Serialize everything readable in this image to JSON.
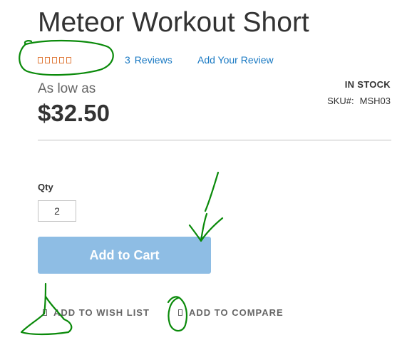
{
  "product": {
    "title": "Meteor Workout Short",
    "rating_stars": 5,
    "reviews_count": "3",
    "reviews_label": "Reviews",
    "add_review_label": "Add Your Review",
    "as_low_as_label": "As low as",
    "price": "$32.50",
    "stock_status": "IN STOCK",
    "sku_label": "SKU#:",
    "sku_value": "MSH03"
  },
  "cart": {
    "qty_label": "Qty",
    "qty_value": "2",
    "add_to_cart_label": "Add to Cart"
  },
  "actions": {
    "wishlist_label": "Add to Wish List",
    "compare_label": "Add to Compare"
  },
  "colors": {
    "link": "#1979c3",
    "button": "#8ebde4",
    "star_outline": "#e07b3c",
    "annotation": "#0a8a0a"
  },
  "icons": {
    "star": "star-outline-icon",
    "wishlist": "heart-icon",
    "compare": "compare-icon"
  }
}
